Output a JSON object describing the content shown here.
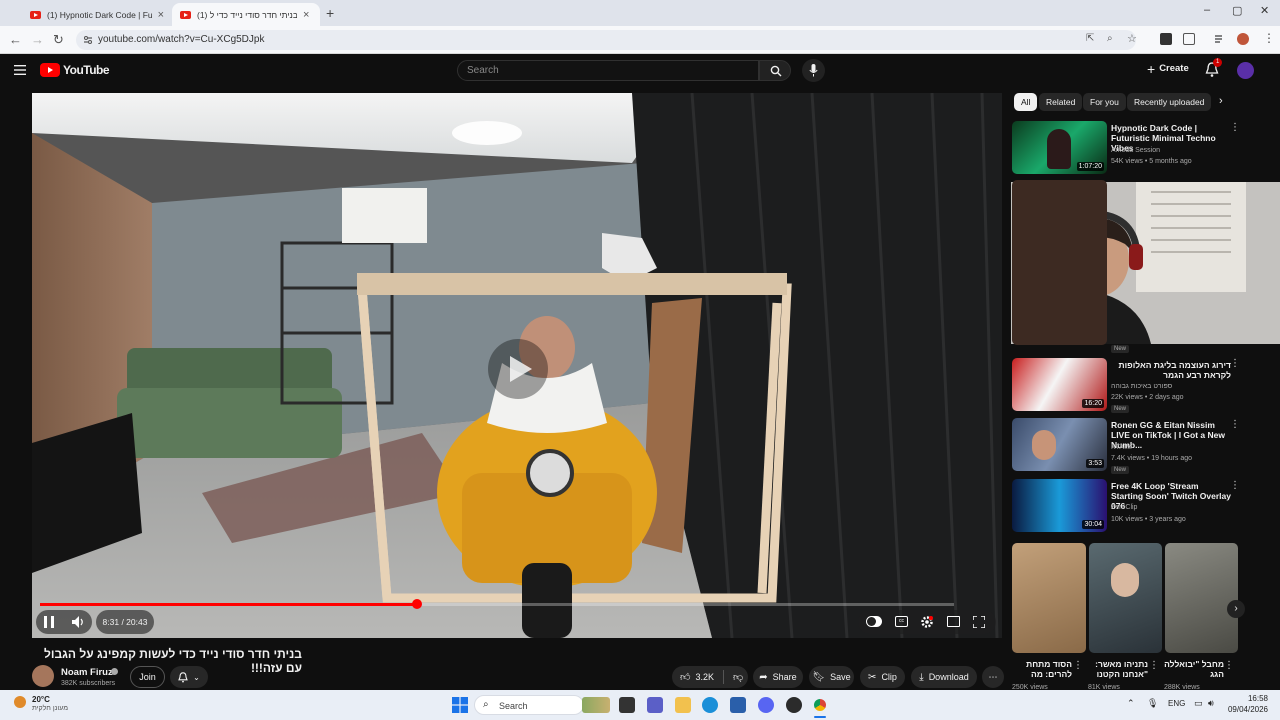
{
  "browser": {
    "tabs": [
      {
        "title": "(1) Hypnotic Dark Code | Futur..."
      },
      {
        "title": "(1) בניתי חדר סודי נייד כדי ל"
      }
    ],
    "new_tab": "+",
    "url": "youtube.com/watch?v=Cu-XCg5DJpk"
  },
  "youtube": {
    "logo": "YouTube",
    "search_placeholder": "Search",
    "create_label": "Create",
    "notification_count": "1"
  },
  "player": {
    "time": "8:31 / 20:43",
    "progress_fraction": 0.412
  },
  "video": {
    "title": "בניתי חדר סודי נייד כדי לעשות קמפינג על הגבול עם עזה!!!",
    "channel": "Noam Firuz",
    "subscribers": "382K subscribers",
    "join_label": "Join",
    "likes": "3.2K",
    "share_label": "Share",
    "save_label": "Save",
    "clip_label": "Clip",
    "download_label": "Download"
  },
  "sidebar": {
    "chips": [
      "All",
      "Related",
      "For you",
      "Recently uploaded"
    ],
    "items": [
      {
        "title": "Hypnotic Dark Code | Futuristic Minimal Techno Vibes",
        "channel": "Amoda Session",
        "meta": "54K views • 5 months ago",
        "duration": "1:07:20",
        "new": ""
      },
      {
        "title": "דירוג העוצמה בליגת האלופות לקראת רבע הגמר",
        "channel": "ספורט באיכות גבוהה",
        "meta": "22K views • 2 days ago",
        "duration": "16:20",
        "new": "New",
        "pre_new": "New"
      },
      {
        "title": "Ronen GG & Eitan Nissim LIVE on TikTok | I Got a New Numb...",
        "channel": "KTAIM",
        "meta": "7.4K views • 19 hours ago",
        "duration": "3:53",
        "new": "New"
      },
      {
        "title": "Free 4K Loop 'Stream Starting Soon' Twitch Overlay 076",
        "channel": "ZeroClip",
        "meta": "10K views • 3 years ago",
        "duration": "30:04",
        "new": ""
      }
    ],
    "shorts": [
      {
        "title": "הסוד מתחת להרים: מה",
        "meta": "250K views"
      },
      {
        "title": "נתניהו מאשר: \"אנחנו הקטנו",
        "meta": "81K views"
      },
      {
        "title": "מחבל \"יבואללה הגג",
        "meta": "288K views"
      }
    ]
  },
  "taskbar": {
    "weather_temp": "20°C",
    "weather_desc": "מעונן חלקית",
    "search_label": "Search",
    "lang": "ENG",
    "time": "16:58",
    "date": "09/04/2026"
  },
  "colors": {
    "yt_red": "#ff0000",
    "bg": "#0f0f0f",
    "chip": "#272727"
  }
}
